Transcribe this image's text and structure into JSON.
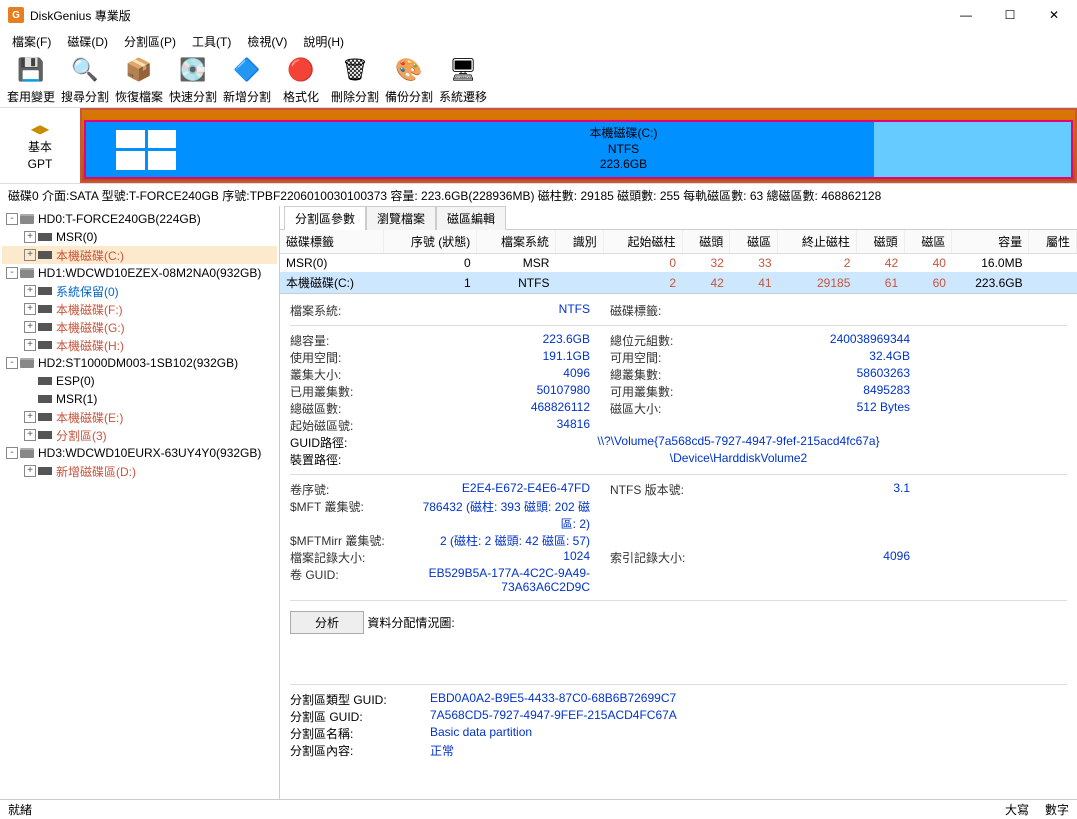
{
  "window": {
    "title": "DiskGenius 專業版"
  },
  "menu": [
    "檔案(F)",
    "磁碟(D)",
    "分割區(P)",
    "工具(T)",
    "檢視(V)",
    "說明(H)"
  ],
  "toolbar": [
    {
      "label": "套用變更",
      "icon": "💾"
    },
    {
      "label": "搜尋分割",
      "icon": "🔍"
    },
    {
      "label": "恢復檔案",
      "icon": "📦"
    },
    {
      "label": "快速分割",
      "icon": "💽"
    },
    {
      "label": "新增分割",
      "icon": "🔷"
    },
    {
      "label": "格式化",
      "icon": "🔴"
    },
    {
      "label": "刪除分割",
      "icon": "🗑"
    },
    {
      "label": "備份分割",
      "icon": "🎨"
    },
    {
      "label": "系統遷移",
      "icon": "🖥"
    }
  ],
  "diskmap": {
    "nav_label1": "基本",
    "nav_label2": "GPT",
    "part_label": "本機磁碟(C:)",
    "part_fs": "NTFS",
    "part_size": "223.6GB"
  },
  "statusline": "磁碟0 介面:SATA 型號:T-FORCE240GB 序號:TPBF2206010030100373 容量: 223.6GB(228936MB) 磁柱數: 29185 磁頭數: 255 每軌磁區數: 63 總磁區數: 468862128",
  "tree": [
    {
      "ind": 0,
      "tw": "-",
      "ico": "disk",
      "cls": "",
      "text": "HD0:T-FORCE240GB(224GB)"
    },
    {
      "ind": 1,
      "tw": "+",
      "ico": "part",
      "cls": "",
      "text": "MSR(0)"
    },
    {
      "ind": 1,
      "tw": "+",
      "ico": "part",
      "cls": "orange sel",
      "text": "本機磁碟(C:)"
    },
    {
      "ind": 0,
      "tw": "-",
      "ico": "disk",
      "cls": "",
      "text": "HD1:WDCWD10EZEX-08M2NA0(932GB)"
    },
    {
      "ind": 1,
      "tw": "+",
      "ico": "part",
      "cls": "blue",
      "text": "系統保留(0)"
    },
    {
      "ind": 1,
      "tw": "+",
      "ico": "part",
      "cls": "orange",
      "text": "本機磁碟(F:)"
    },
    {
      "ind": 1,
      "tw": "+",
      "ico": "part",
      "cls": "orange",
      "text": "本機磁碟(G:)"
    },
    {
      "ind": 1,
      "tw": "+",
      "ico": "part",
      "cls": "orange",
      "text": "本機磁碟(H:)"
    },
    {
      "ind": 0,
      "tw": "-",
      "ico": "disk",
      "cls": "",
      "text": "HD2:ST1000DM003-1SB102(932GB)"
    },
    {
      "ind": 1,
      "tw": "",
      "ico": "part",
      "cls": "",
      "text": "ESP(0)"
    },
    {
      "ind": 1,
      "tw": "",
      "ico": "part",
      "cls": "",
      "text": "MSR(1)"
    },
    {
      "ind": 1,
      "tw": "+",
      "ico": "part",
      "cls": "orange",
      "text": "本機磁碟(E:)"
    },
    {
      "ind": 1,
      "tw": "+",
      "ico": "part",
      "cls": "orange",
      "text": "分割區(3)"
    },
    {
      "ind": 0,
      "tw": "-",
      "ico": "disk",
      "cls": "",
      "text": "HD3:WDCWD10EURX-63UY4Y0(932GB)"
    },
    {
      "ind": 1,
      "tw": "+",
      "ico": "part",
      "cls": "orange",
      "text": "新增磁碟區(D:)"
    }
  ],
  "tabs": [
    "分割區參數",
    "瀏覽檔案",
    "磁區編輯"
  ],
  "grid": {
    "headers": [
      "磁碟標籤",
      "序號 (狀態)",
      "檔案系統",
      "識別",
      "起始磁柱",
      "磁頭",
      "磁區",
      "終止磁柱",
      "磁頭",
      "磁區",
      "容量",
      "屬性"
    ],
    "rows": [
      {
        "sel": false,
        "cells": [
          "MSR(0)",
          "0",
          "MSR",
          "",
          "0",
          "32",
          "33",
          "2",
          "42",
          "40",
          "16.0MB",
          ""
        ]
      },
      {
        "sel": true,
        "cells": [
          "本機磁碟(C:)",
          "1",
          "NTFS",
          "",
          "2",
          "42",
          "41",
          "29185",
          "61",
          "60",
          "223.6GB",
          ""
        ]
      }
    ]
  },
  "details": {
    "block1": [
      [
        "檔案系統:",
        "NTFS",
        "磁碟標籤:",
        ""
      ]
    ],
    "block2": [
      [
        "總容量:",
        "223.6GB",
        "總位元組數:",
        "240038969344"
      ],
      [
        "使用空間:",
        "191.1GB",
        "可用空間:",
        "32.4GB"
      ],
      [
        "叢集大小:",
        "4096",
        "總叢集數:",
        "58603263"
      ],
      [
        "已用叢集數:",
        "50107980",
        "可用叢集數:",
        "8495283"
      ],
      [
        "總磁區數:",
        "468826112",
        "磁區大小:",
        "512 Bytes"
      ],
      [
        "起始磁區號:",
        "34816",
        "",
        ""
      ]
    ],
    "guid_path_label": "GUID路徑:",
    "guid_path": "\\\\?\\Volume{7a568cd5-7927-4947-9fef-215acd4fc67a}",
    "device_path_label": "裝置路徑:",
    "device_path": "\\Device\\HarddiskVolume2",
    "block3": [
      [
        "卷序號:",
        "E2E4-E672-E4E6-47FD",
        "NTFS 版本號:",
        "3.1"
      ],
      [
        "$MFT 叢集號:",
        "786432 (磁柱: 393 磁頭: 202 磁區: 2)",
        "",
        ""
      ],
      [
        "$MFTMirr 叢集號:",
        "2 (磁柱: 2 磁頭: 42 磁區: 57)",
        "",
        ""
      ],
      [
        "檔案記錄大小:",
        "1024",
        "索引記錄大小:",
        "4096"
      ],
      [
        "卷 GUID:",
        "EB529B5A-177A-4C2C-9A49-73A63A6C2D9C",
        "",
        ""
      ]
    ],
    "analyze_label": "分析",
    "alloc_label": "資料分配情況圖:",
    "block4": [
      [
        "分割區類型 GUID:",
        "EBD0A0A2-B9E5-4433-87C0-68B6B72699C7"
      ],
      [
        "分割區 GUID:",
        "7A568CD5-7927-4947-9FEF-215ACD4FC67A"
      ],
      [
        "分割區名稱:",
        "Basic data partition"
      ],
      [
        "分割區內容:",
        "正常"
      ]
    ]
  },
  "footer": {
    "left": "就緒",
    "caps": "大寫",
    "num": "數字"
  }
}
